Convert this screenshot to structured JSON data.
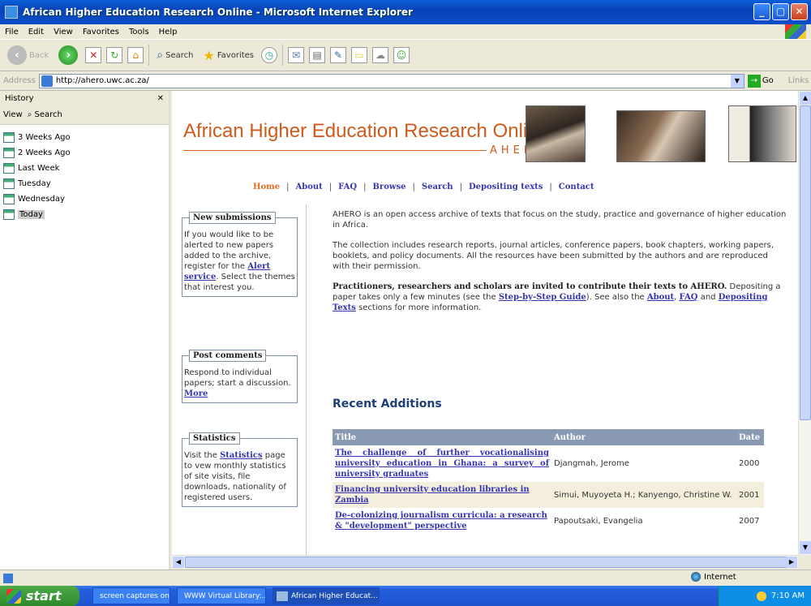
{
  "window": {
    "title": "African Higher Education Research Online - Microsoft Internet Explorer",
    "min_label": "_",
    "max_label": "▢",
    "close_label": "✕"
  },
  "menu": [
    "File",
    "Edit",
    "View",
    "Favorites",
    "Tools",
    "Help"
  ],
  "toolbar": {
    "back_label": "Back",
    "search_label": "Search",
    "favorites_label": "Favorites"
  },
  "address": {
    "label": "Address",
    "url": "http://ahero.uwc.ac.za/",
    "go_label": "Go",
    "links_label": "Links"
  },
  "history": {
    "title": "History",
    "close_label": "✕",
    "view_label": "View",
    "search_label": "Search",
    "items": [
      "3 Weeks Ago",
      "2 Weeks Ago",
      "Last Week",
      "Tuesday",
      "Wednesday",
      "Today"
    ]
  },
  "site": {
    "title": "African Higher Education Research Online",
    "subtitle": "AHERO",
    "nav": [
      "Home",
      "About",
      "FAQ",
      "Browse",
      "Search",
      "Depositing texts",
      "Contact"
    ]
  },
  "sidebar": {
    "new_submissions": {
      "legend": "New submissions",
      "text_before": "If you would like to be alerted to new papers added to the archive, register for the ",
      "link": "Alert service",
      "text_after": ". Select the themes that interest you."
    },
    "post_comments": {
      "legend": "Post comments",
      "text": "Respond to individual papers; start a discussion. ",
      "link": "More"
    },
    "statistics": {
      "legend": "Statistics",
      "text_before": "Visit the ",
      "link": "Statistics",
      "text_after": " page to vew monthly statistics of site visits, file downloads, nationality of registered users."
    }
  },
  "main": {
    "para1": "AHERO is an open access archive of texts that focus on the study, practice and governance of higher education in Africa.",
    "para2": "The collection includes research reports, journal articles, conference papers, book chapters, working papers, booklets, and policy documents. All the resources have been submitted by the authors and are reproduced with their permission.",
    "para3_bold": "Practitioners, researchers and scholars are invited to contribute their texts to AHERO.",
    "para3_a": " Depositing a paper takes only a few minutes (see the ",
    "para3_link1": "Step-by-Step Guide",
    "para3_b": "). See also the ",
    "para3_link2": "About",
    "para3_c": ", ",
    "para3_link3": "FAQ",
    "para3_d": " and ",
    "para3_link4": "Depositing Texts",
    "para3_e": " sections for more information."
  },
  "recent": {
    "heading": "Recent Additions",
    "columns": [
      "Title",
      "Author",
      "Date"
    ],
    "rows": [
      {
        "title": "The challenge of further vocationalising university education in Ghana: a survey of university graduates",
        "author": "Djangmah, Jerome",
        "date": "2000"
      },
      {
        "title": "Financing university education libraries in Zambia",
        "author": "Simui, Muyoyeta H.; Kanyengo, Christine W.",
        "date": "2001"
      },
      {
        "title": "De-colonizing journalism curricula: a research & \"development\" perspective",
        "author": "Papoutsaki, Evangelia",
        "date": "2007"
      }
    ]
  },
  "status": {
    "zone": "Internet"
  },
  "taskbar": {
    "start": "start",
    "tasks": [
      "screen captures on c...",
      "WWW Virtual Library:...",
      "African Higher Educat..."
    ],
    "clock": "7:10 AM"
  }
}
